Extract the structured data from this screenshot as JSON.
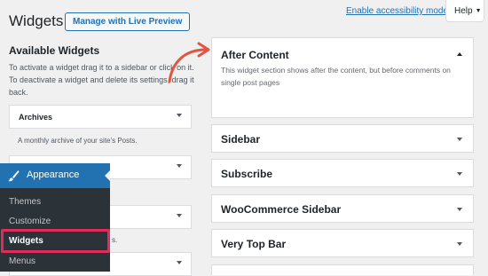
{
  "header": {
    "title": "Widgets",
    "live_preview_label": "Manage with Live Preview",
    "accessibility_link": "Enable accessibility mode",
    "help_label": "Help"
  },
  "available": {
    "title": "Available Widgets",
    "description": "To activate a widget drag it to a sidebar or click on it. To deactivate a widget and delete its settings, drag it back.",
    "widgets": [
      {
        "label": "Archives",
        "description": "A monthly archive of your site’s Posts."
      },
      {
        "label": ""
      },
      {
        "label": "",
        "description": "s."
      },
      {
        "label": ""
      }
    ]
  },
  "admin_menu": {
    "section": "Appearance",
    "items": [
      "Themes",
      "Customize",
      "Widgets",
      "Menus"
    ],
    "active": "Widgets"
  },
  "sidebars": [
    {
      "title": "After Content",
      "description": "This widget section shows after the content, but before comments on single post pages",
      "expanded": true
    },
    {
      "title": "Sidebar"
    },
    {
      "title": "Subscribe"
    },
    {
      "title": "WooCommerce Sidebar"
    },
    {
      "title": "Very Top Bar"
    }
  ],
  "colors": {
    "accent": "#2271b1",
    "highlight": "#e02c5a",
    "menu_bg": "#2c3338",
    "arrow": "#e2553f"
  }
}
